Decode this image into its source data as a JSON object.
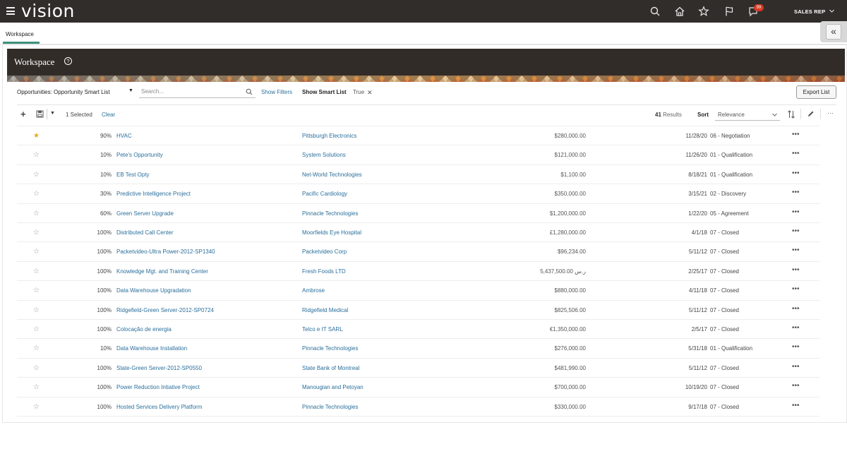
{
  "app": {
    "brand": "vision",
    "role": "SALES REP",
    "notification_count": "99"
  },
  "tabs": [
    {
      "label": "Workspace",
      "active": true
    }
  ],
  "workspace": {
    "title": "Workspace"
  },
  "filters": {
    "smart_list": "Opportunities: Opportunity Smart List",
    "search_placeholder": "Search...",
    "show_filters": "Show Filters",
    "show_smart_list_label": "Show Smart List",
    "show_smart_list_value": "True",
    "export_label": "Export List"
  },
  "toolbar": {
    "selected_text": "1 Selected",
    "clear_label": "Clear",
    "results_count": "41",
    "results_label": "Results",
    "sort_label": "Sort",
    "sort_value": "Relevance"
  },
  "colors": {
    "topbar": "#312d2a",
    "link": "#2a6f9b",
    "star_active": "#e5a921",
    "tab_accent": "#3d8f7a",
    "badge": "#d63b25"
  },
  "rows": [
    {
      "starred": true,
      "probability": "90%",
      "name": "HVAC",
      "account": "Pittsburgh Electronics",
      "amount": "$280,000.00",
      "close_date": "11/28/20",
      "stage": "06 - Negotiation"
    },
    {
      "starred": false,
      "probability": "10%",
      "name": "Pete's Opportunity",
      "account": "System Solutions",
      "amount": "$121,000.00",
      "close_date": "11/26/20",
      "stage": "01 - Qualification"
    },
    {
      "starred": false,
      "probability": "10%",
      "name": "EB Test Opty",
      "account": "Net-World Technologies",
      "amount": "$1,100.00",
      "close_date": "8/18/21",
      "stage": "01 - Qualification"
    },
    {
      "starred": false,
      "probability": "30%",
      "name": "Predictive Intelligence Project",
      "account": "Pacific Cardiology",
      "amount": "$350,000.00",
      "close_date": "3/15/21",
      "stage": "02 - Discovery"
    },
    {
      "starred": false,
      "probability": "60%",
      "name": "Green Server Upgrade",
      "account": "Pinnacle Technologies",
      "amount": "$1,200,000.00",
      "close_date": "1/22/20",
      "stage": "05 - Agreement"
    },
    {
      "starred": false,
      "probability": "100%",
      "name": "Distributed Call Center",
      "account": "Moorfields Eye Hospital",
      "amount": "£1,280,000.00",
      "close_date": "4/1/18",
      "stage": "07 - Closed"
    },
    {
      "starred": false,
      "probability": "100%",
      "name": "Packetvideo-Ultra Power-2012-SP1340",
      "account": "Packetvideo Corp",
      "amount": "$96,234.00",
      "close_date": "5/11/12",
      "stage": "07 - Closed"
    },
    {
      "starred": false,
      "probability": "100%",
      "name": "Knowledge Mgt. and Training Center",
      "account": "Fresh Foods LTD",
      "amount": "5,437,500.00 ر.س",
      "close_date": "2/25/17",
      "stage": "07 - Closed"
    },
    {
      "starred": false,
      "probability": "100%",
      "name": "Data Warehouse Upgradation",
      "account": "Ambrose",
      "amount": "$880,000.00",
      "close_date": "4/11/18",
      "stage": "07 - Closed"
    },
    {
      "starred": false,
      "probability": "100%",
      "name": "Ridgefield-Green Server-2012-SP0724",
      "account": "Ridgefield Medical",
      "amount": "$825,506.00",
      "close_date": "5/11/12",
      "stage": "07 - Closed"
    },
    {
      "starred": false,
      "probability": "100%",
      "name": "Colocação de energia",
      "account": "Telco e IT SARL",
      "amount": "€1,350,000.00",
      "close_date": "2/5/17",
      "stage": "07 - Closed"
    },
    {
      "starred": false,
      "probability": "10%",
      "name": "Data Warehouse Installation",
      "account": "Pinnacle Technologies",
      "amount": "$276,000.00",
      "close_date": "5/31/18",
      "stage": "01 - Qualification"
    },
    {
      "starred": false,
      "probability": "100%",
      "name": "State-Green Server-2012-SP0550",
      "account": "State Bank of Montreal",
      "amount": "$481,990.00",
      "close_date": "5/11/12",
      "stage": "07 - Closed"
    },
    {
      "starred": false,
      "probability": "100%",
      "name": "Power Reduction Intiative Project",
      "account": "Manougian and Petoyan",
      "amount": "$700,000.00",
      "close_date": "10/19/20",
      "stage": "07 - Closed"
    },
    {
      "starred": false,
      "probability": "100%",
      "name": "Hosted Services Delivery Platform",
      "account": "Pinnacle Technologies",
      "amount": "$330,000.00",
      "close_date": "9/17/18",
      "stage": "07 - Closed"
    }
  ]
}
